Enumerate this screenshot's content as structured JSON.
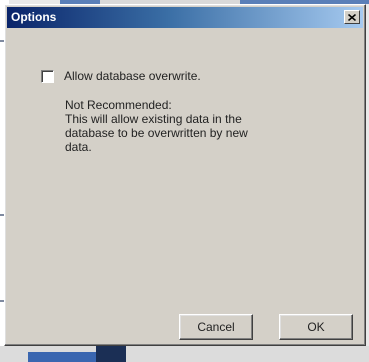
{
  "window": {
    "title": "Options",
    "close_icon": "close-icon"
  },
  "option": {
    "checkbox_label": "Allow database overwrite.",
    "checked": false
  },
  "note": {
    "lines": [
      "Not Recommended:",
      "This will allow existing data in the",
      "database to be overwritten by new",
      "data."
    ]
  },
  "buttons": {
    "cancel_label": "Cancel",
    "ok_label": "OK"
  },
  "colors": {
    "titlebar_start": "#0a246a",
    "titlebar_end": "#a6caf0",
    "dialog_face": "#d4d0c8"
  }
}
